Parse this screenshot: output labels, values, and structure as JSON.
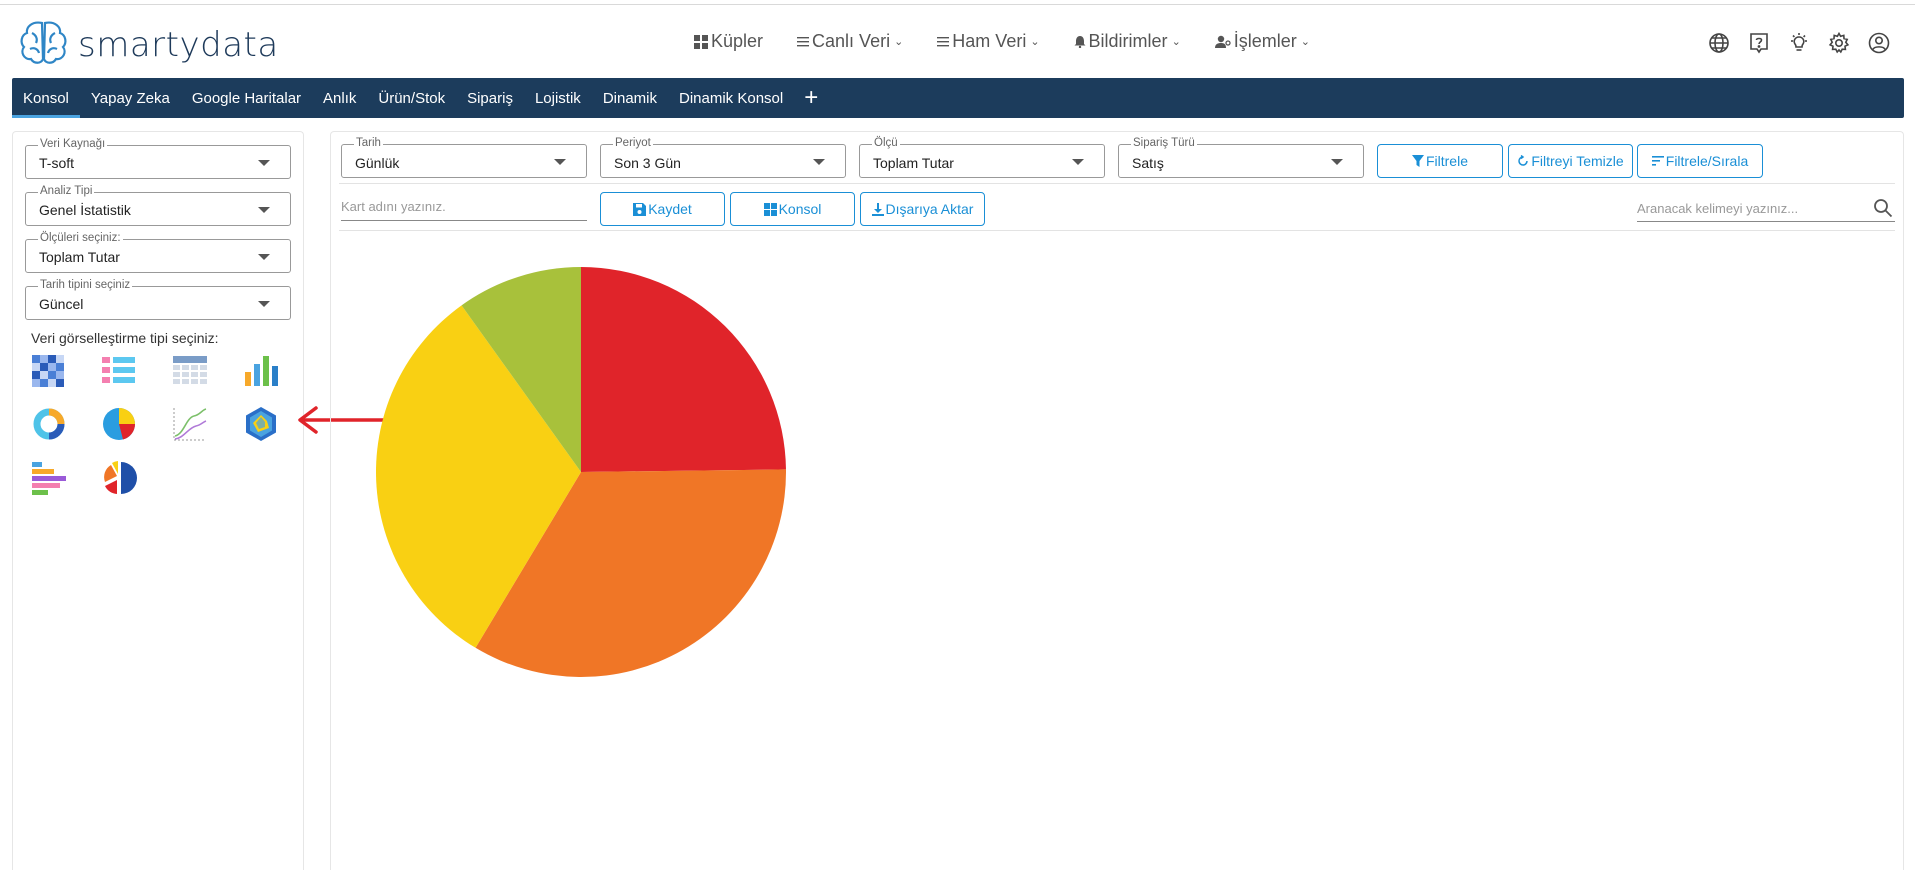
{
  "brand": {
    "name_part1": "smarty",
    "name_part2": "data"
  },
  "topnav": [
    {
      "label": "Küpler",
      "icon": "cubes-icon",
      "has_menu": false
    },
    {
      "label": "Canlı Veri",
      "icon": "list-icon",
      "has_menu": true
    },
    {
      "label": "Ham Veri",
      "icon": "list-icon",
      "has_menu": true
    },
    {
      "label": "Bildirimler",
      "icon": "bell-icon",
      "has_menu": true
    },
    {
      "label": "İşlemler",
      "icon": "user-gear-icon",
      "has_menu": true
    }
  ],
  "top_icons": [
    "globe-icon",
    "help-icon",
    "lightbulb-icon",
    "gear-icon",
    "user-icon"
  ],
  "tabs": [
    "Konsol",
    "Yapay Zeka",
    "Google Haritalar",
    "Anlık",
    "Ürün/Stok",
    "Sipariş",
    "Lojistik",
    "Dinamik",
    "Dinamik Konsol"
  ],
  "active_tab": "Konsol",
  "left_panel": {
    "selects": [
      {
        "label": "Veri Kaynağı",
        "value": "T-soft"
      },
      {
        "label": "Analiz Tipi",
        "value": "Genel İstatistik"
      },
      {
        "label": "Ölçüleri seçiniz:",
        "value": "Toplam Tutar"
      },
      {
        "label": "Tarih tipini seçiniz",
        "value": "Güncel"
      }
    ],
    "viz_label": "Veri görselleştirme tipi seçiniz:",
    "viz_types": [
      "heatmap-icon",
      "list-view-icon",
      "table-icon",
      "bar-chart-icon",
      "donut-chart-icon",
      "pie-chart-icon",
      "line-chart-icon",
      "radar-chart-icon",
      "horizontal-bar-icon",
      "exploded-pie-icon"
    ],
    "selected_viz": "radar-chart-icon"
  },
  "filters": [
    {
      "label": "Tarih",
      "value": "Günlük"
    },
    {
      "label": "Periyot",
      "value": "Son 3 Gün"
    },
    {
      "label": "Ölçü",
      "value": "Toplam Tutar"
    },
    {
      "label": "Sipariş Türü",
      "value": "Satış"
    }
  ],
  "filter_buttons": {
    "filter": "Filtrele",
    "clear": "Filtreyi Temizle",
    "filter_sort": "Filtrele/Sırala"
  },
  "card_name_placeholder": "Kart adını yazınız.",
  "action_buttons": {
    "save": "Kaydet",
    "console": "Konsol",
    "export": "Dışarıya Aktar"
  },
  "search_placeholder": "Aranacak kelimeyi yazınız...",
  "colors": {
    "navbar": "#1c3c5c",
    "accent": "#1a8fd6",
    "arrow": "#e0242a"
  },
  "chart_data": {
    "type": "pie",
    "slices": [
      {
        "value": 24.8,
        "color": "#e0242a"
      },
      {
        "value": 33.8,
        "color": "#f07626"
      },
      {
        "value": 31.5,
        "color": "#f9d013"
      },
      {
        "value": 9.9,
        "color": "#a8c13b"
      }
    ]
  }
}
